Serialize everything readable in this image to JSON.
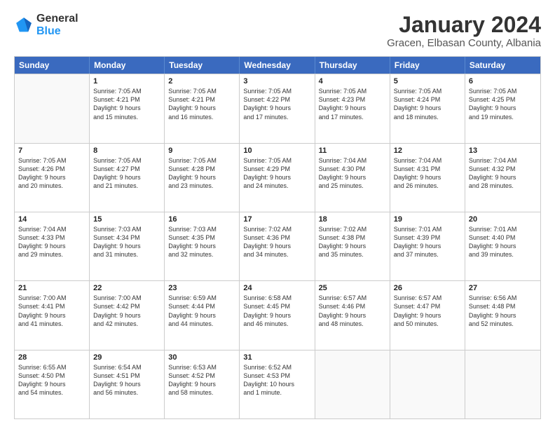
{
  "header": {
    "logo": {
      "general": "General",
      "blue": "Blue"
    },
    "title": "January 2024",
    "subtitle": "Gracen, Elbasan County, Albania"
  },
  "weekdays": [
    "Sunday",
    "Monday",
    "Tuesday",
    "Wednesday",
    "Thursday",
    "Friday",
    "Saturday"
  ],
  "rows": [
    [
      {
        "day": "",
        "lines": []
      },
      {
        "day": "1",
        "lines": [
          "Sunrise: 7:05 AM",
          "Sunset: 4:21 PM",
          "Daylight: 9 hours",
          "and 15 minutes."
        ]
      },
      {
        "day": "2",
        "lines": [
          "Sunrise: 7:05 AM",
          "Sunset: 4:21 PM",
          "Daylight: 9 hours",
          "and 16 minutes."
        ]
      },
      {
        "day": "3",
        "lines": [
          "Sunrise: 7:05 AM",
          "Sunset: 4:22 PM",
          "Daylight: 9 hours",
          "and 17 minutes."
        ]
      },
      {
        "day": "4",
        "lines": [
          "Sunrise: 7:05 AM",
          "Sunset: 4:23 PM",
          "Daylight: 9 hours",
          "and 17 minutes."
        ]
      },
      {
        "day": "5",
        "lines": [
          "Sunrise: 7:05 AM",
          "Sunset: 4:24 PM",
          "Daylight: 9 hours",
          "and 18 minutes."
        ]
      },
      {
        "day": "6",
        "lines": [
          "Sunrise: 7:05 AM",
          "Sunset: 4:25 PM",
          "Daylight: 9 hours",
          "and 19 minutes."
        ]
      }
    ],
    [
      {
        "day": "7",
        "lines": [
          "Sunrise: 7:05 AM",
          "Sunset: 4:26 PM",
          "Daylight: 9 hours",
          "and 20 minutes."
        ]
      },
      {
        "day": "8",
        "lines": [
          "Sunrise: 7:05 AM",
          "Sunset: 4:27 PM",
          "Daylight: 9 hours",
          "and 21 minutes."
        ]
      },
      {
        "day": "9",
        "lines": [
          "Sunrise: 7:05 AM",
          "Sunset: 4:28 PM",
          "Daylight: 9 hours",
          "and 23 minutes."
        ]
      },
      {
        "day": "10",
        "lines": [
          "Sunrise: 7:05 AM",
          "Sunset: 4:29 PM",
          "Daylight: 9 hours",
          "and 24 minutes."
        ]
      },
      {
        "day": "11",
        "lines": [
          "Sunrise: 7:04 AM",
          "Sunset: 4:30 PM",
          "Daylight: 9 hours",
          "and 25 minutes."
        ]
      },
      {
        "day": "12",
        "lines": [
          "Sunrise: 7:04 AM",
          "Sunset: 4:31 PM",
          "Daylight: 9 hours",
          "and 26 minutes."
        ]
      },
      {
        "day": "13",
        "lines": [
          "Sunrise: 7:04 AM",
          "Sunset: 4:32 PM",
          "Daylight: 9 hours",
          "and 28 minutes."
        ]
      }
    ],
    [
      {
        "day": "14",
        "lines": [
          "Sunrise: 7:04 AM",
          "Sunset: 4:33 PM",
          "Daylight: 9 hours",
          "and 29 minutes."
        ]
      },
      {
        "day": "15",
        "lines": [
          "Sunrise: 7:03 AM",
          "Sunset: 4:34 PM",
          "Daylight: 9 hours",
          "and 31 minutes."
        ]
      },
      {
        "day": "16",
        "lines": [
          "Sunrise: 7:03 AM",
          "Sunset: 4:35 PM",
          "Daylight: 9 hours",
          "and 32 minutes."
        ]
      },
      {
        "day": "17",
        "lines": [
          "Sunrise: 7:02 AM",
          "Sunset: 4:36 PM",
          "Daylight: 9 hours",
          "and 34 minutes."
        ]
      },
      {
        "day": "18",
        "lines": [
          "Sunrise: 7:02 AM",
          "Sunset: 4:38 PM",
          "Daylight: 9 hours",
          "and 35 minutes."
        ]
      },
      {
        "day": "19",
        "lines": [
          "Sunrise: 7:01 AM",
          "Sunset: 4:39 PM",
          "Daylight: 9 hours",
          "and 37 minutes."
        ]
      },
      {
        "day": "20",
        "lines": [
          "Sunrise: 7:01 AM",
          "Sunset: 4:40 PM",
          "Daylight: 9 hours",
          "and 39 minutes."
        ]
      }
    ],
    [
      {
        "day": "21",
        "lines": [
          "Sunrise: 7:00 AM",
          "Sunset: 4:41 PM",
          "Daylight: 9 hours",
          "and 41 minutes."
        ]
      },
      {
        "day": "22",
        "lines": [
          "Sunrise: 7:00 AM",
          "Sunset: 4:42 PM",
          "Daylight: 9 hours",
          "and 42 minutes."
        ]
      },
      {
        "day": "23",
        "lines": [
          "Sunrise: 6:59 AM",
          "Sunset: 4:44 PM",
          "Daylight: 9 hours",
          "and 44 minutes."
        ]
      },
      {
        "day": "24",
        "lines": [
          "Sunrise: 6:58 AM",
          "Sunset: 4:45 PM",
          "Daylight: 9 hours",
          "and 46 minutes."
        ]
      },
      {
        "day": "25",
        "lines": [
          "Sunrise: 6:57 AM",
          "Sunset: 4:46 PM",
          "Daylight: 9 hours",
          "and 48 minutes."
        ]
      },
      {
        "day": "26",
        "lines": [
          "Sunrise: 6:57 AM",
          "Sunset: 4:47 PM",
          "Daylight: 9 hours",
          "and 50 minutes."
        ]
      },
      {
        "day": "27",
        "lines": [
          "Sunrise: 6:56 AM",
          "Sunset: 4:48 PM",
          "Daylight: 9 hours",
          "and 52 minutes."
        ]
      }
    ],
    [
      {
        "day": "28",
        "lines": [
          "Sunrise: 6:55 AM",
          "Sunset: 4:50 PM",
          "Daylight: 9 hours",
          "and 54 minutes."
        ]
      },
      {
        "day": "29",
        "lines": [
          "Sunrise: 6:54 AM",
          "Sunset: 4:51 PM",
          "Daylight: 9 hours",
          "and 56 minutes."
        ]
      },
      {
        "day": "30",
        "lines": [
          "Sunrise: 6:53 AM",
          "Sunset: 4:52 PM",
          "Daylight: 9 hours",
          "and 58 minutes."
        ]
      },
      {
        "day": "31",
        "lines": [
          "Sunrise: 6:52 AM",
          "Sunset: 4:53 PM",
          "Daylight: 10 hours",
          "and 1 minute."
        ]
      },
      {
        "day": "",
        "lines": []
      },
      {
        "day": "",
        "lines": []
      },
      {
        "day": "",
        "lines": []
      }
    ]
  ]
}
